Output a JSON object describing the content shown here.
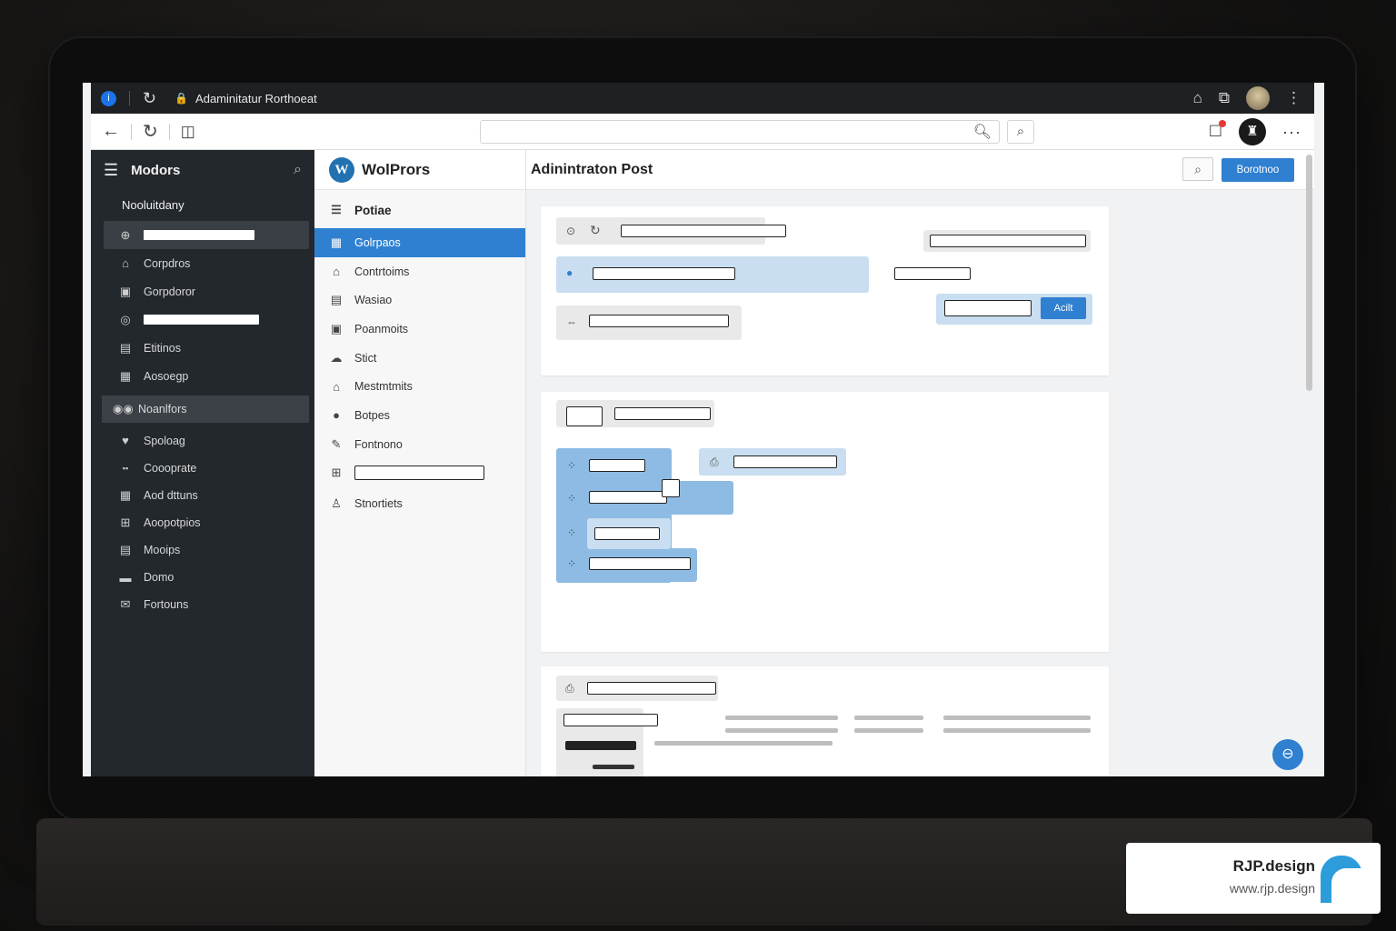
{
  "browser": {
    "tab_title": "Adaminitatur Rorthoeat",
    "info_icon": "i",
    "reload_icon": "↻",
    "lock_icon": "🔒"
  },
  "sidebar": {
    "title": "Modors",
    "subtitle": "Nooluitdany",
    "items": [
      {
        "label": "",
        "icon": "⊕",
        "bar": true,
        "active": true
      },
      {
        "label": "Corpdros",
        "icon": "⌂"
      },
      {
        "label": "Gorpdoror",
        "icon": "▣"
      },
      {
        "label": "",
        "icon": "◎",
        "bar": true
      },
      {
        "label": "Etitinos",
        "icon": "▤"
      },
      {
        "label": "Aosoegp",
        "icon": "▦"
      }
    ],
    "section": {
      "label": "Noanlfors",
      "icon": "👥"
    },
    "items2": [
      {
        "label": "Spoloag",
        "icon": "♥"
      },
      {
        "label": "Coooprate",
        "icon": "▪▪"
      },
      {
        "label": "Aod dttuns",
        "icon": "▦"
      },
      {
        "label": "Aoopotpios",
        "icon": "⊞"
      },
      {
        "label": "Mooips",
        "icon": "▤"
      },
      {
        "label": "Domo",
        "icon": "▬"
      },
      {
        "label": "Fortouns",
        "icon": "✉"
      }
    ]
  },
  "subnav": {
    "brand": "WolPrors",
    "logo": "W",
    "head": "Potiae",
    "items": [
      {
        "label": "Golrpaos",
        "icon": "▦",
        "active": true
      },
      {
        "label": "Contrtoims",
        "icon": "⌂"
      },
      {
        "label": "Wasiao",
        "icon": "▤"
      },
      {
        "label": "Poanmoits",
        "icon": "▣"
      },
      {
        "label": "Stict",
        "icon": "☁"
      },
      {
        "label": "Mestmtmits",
        "icon": "⌂"
      },
      {
        "label": "Botpes",
        "icon": "●"
      },
      {
        "label": "Fontnono",
        "icon": "✎"
      },
      {
        "label": "",
        "icon": "⊞",
        "box": true
      },
      {
        "label": "Stnortiets",
        "icon": "♙"
      }
    ]
  },
  "main": {
    "page_title": "Adinintraton Post",
    "action_button": "Borotnoo",
    "add_button": "Acilt"
  },
  "watermark": {
    "name": "RJP.design",
    "url": "www.rjp.design"
  }
}
